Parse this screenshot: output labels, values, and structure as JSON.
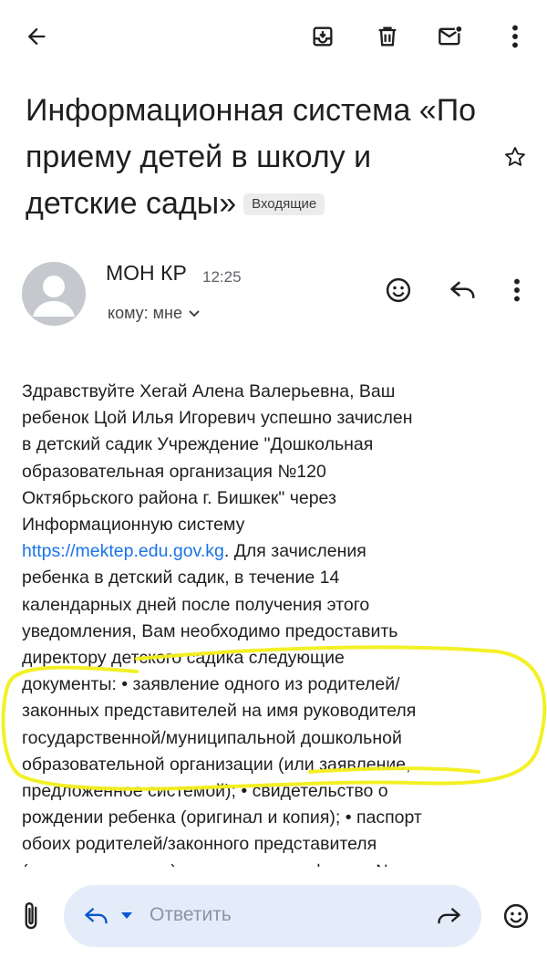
{
  "toolbar": {
    "back": "arrow-back-icon",
    "archive": "archive-icon",
    "delete": "trash-icon",
    "mark_unread": "mark-unread-icon",
    "more": "more-vert-icon"
  },
  "email": {
    "subject": "Информационная система «По приему детей в школу и детские сады»",
    "label": "Входящие",
    "sender": "МОН КР",
    "time": "12:25",
    "recipient": "кому: мне",
    "body_lines": [
      "Здравствуйте Хегай Алена Валерьевна, Ваш",
      "ребенок Цой Илья Игоревич успешно зачислен",
      "в детский садик Учреждение \"Дошкольная",
      "образовательная организация №120",
      "Октябрьского района г. Бишкек\" через",
      "Информационную систему"
    ],
    "link": "https://mektep.edu.gov.kg",
    "body_after_link": ". Для зачисления",
    "body_lines_2": [
      "ребенка в детский садик, в течение 14",
      "календарных дней после получения этого",
      "уведомления, Вам необходимо предоставить",
      "директору детского садика следующие",
      "документы: • заявление одного из родителей/",
      "законных представителей на имя руководителя",
      "государственной/муниципальной дошкольной",
      "образовательной организации (или заявление,",
      "предложенное системой); • свидетельство о",
      "рождении ребенка (оригинал и копия); • паспорт",
      "обоих родителей/законного представителя",
      "(оригинал и копия); • медицинские формы №"
    ]
  },
  "reply_bar": {
    "placeholder": "Ответить"
  },
  "colors": {
    "link": "#1a73e8",
    "highlight": "#f2ef1a",
    "reply_pill": "#e3ecf8"
  }
}
